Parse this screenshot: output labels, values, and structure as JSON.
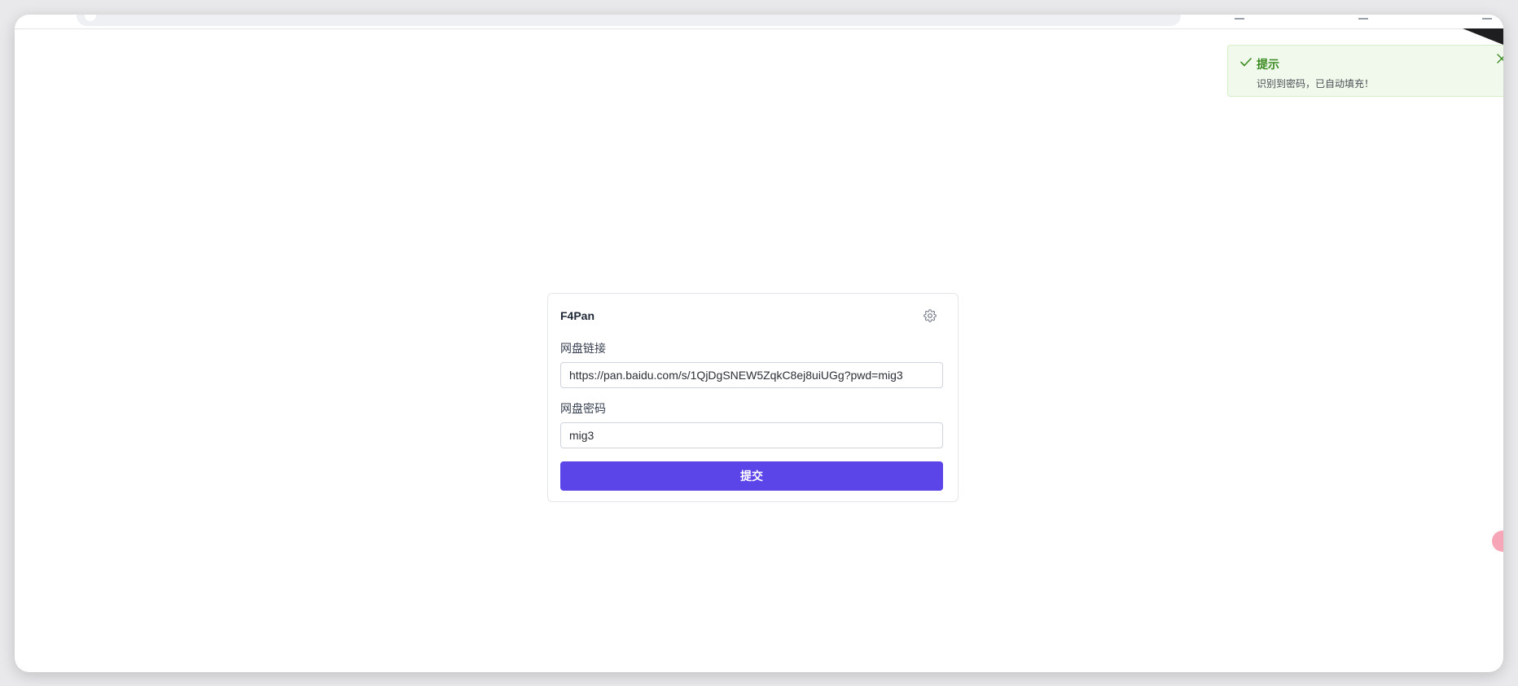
{
  "toast": {
    "title": "提示",
    "message": "识别到密码，已自动填充！",
    "color": "#3a8a1f",
    "icon": "check-icon",
    "close_icon": "close-icon"
  },
  "card": {
    "title": "F4Pan",
    "settings_icon": "gear-icon",
    "link_label": "网盘链接",
    "link_value": "https://pan.baidu.com/s/1QjDgSNEW5ZqkC8ej8uiUGg?pwd=mig3",
    "password_label": "网盘密码",
    "password_value": "mig3",
    "submit_label": "提交",
    "accent_color": "#5b45e8"
  }
}
